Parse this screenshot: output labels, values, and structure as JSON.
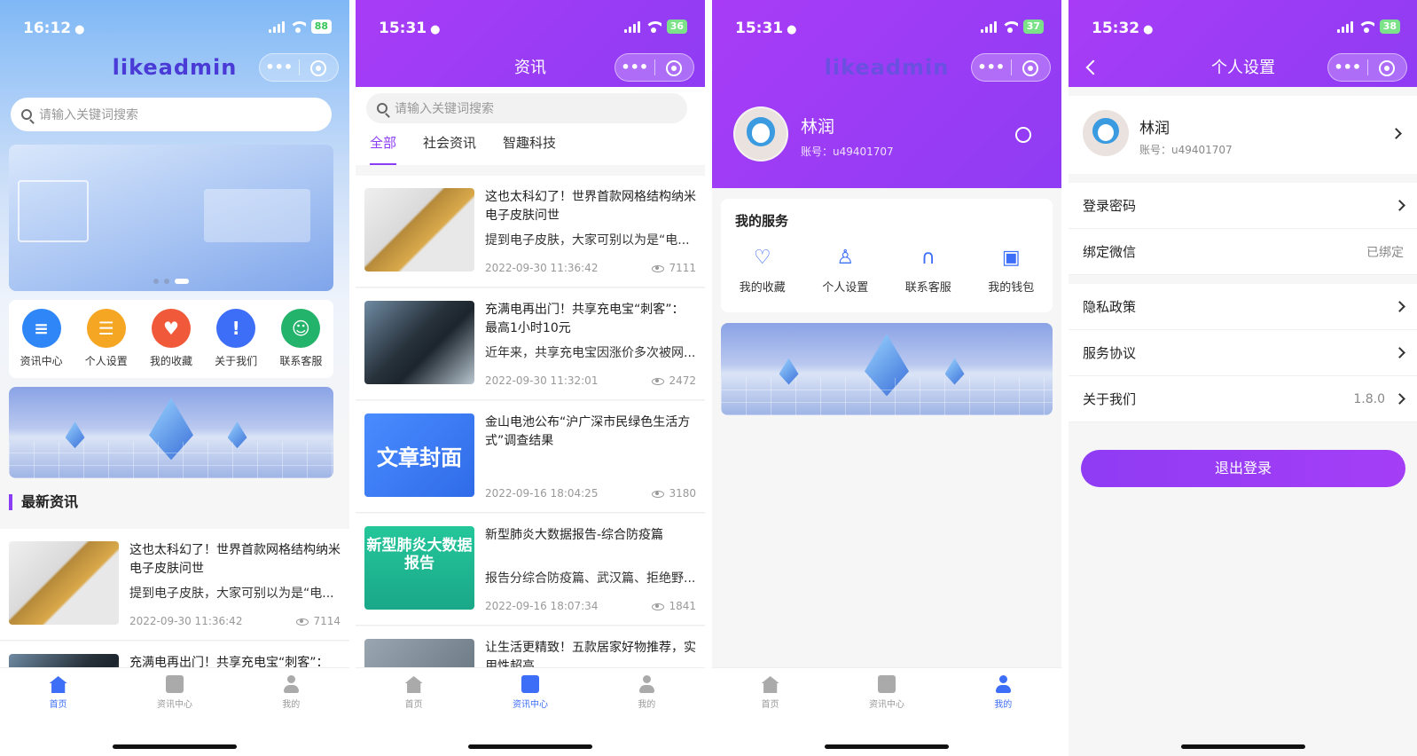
{
  "p1": {
    "time": "16:12",
    "battery": "88",
    "logo": "likeadmin",
    "search_placeholder": "请输入关键词搜索",
    "menu": [
      "资讯中心",
      "个人设置",
      "我的收藏",
      "关于我们",
      "联系客服"
    ],
    "section_title": "最新资讯",
    "news": [
      {
        "title": "这也太科幻了！世界首款网格结构纳米电子皮肤问世",
        "desc": "提到电子皮肤，大家可别以为是“电...",
        "date": "2022-09-30 11:36:42",
        "views": "7114"
      },
      {
        "title": "充满电再出门！共享充电宝“刺客”：",
        "desc": "",
        "date": "",
        "views": ""
      }
    ]
  },
  "p2": {
    "time": "15:31",
    "battery": "36",
    "title": "资讯",
    "search_placeholder": "请输入关键词搜索",
    "tabs": [
      "全部",
      "社会资讯",
      "智趣科技"
    ],
    "news": [
      {
        "title": "这也太科幻了！世界首款网格结构纳米电子皮肤问世",
        "desc": "提到电子皮肤，大家可别以为是“电...",
        "date": "2022-09-30 11:36:42",
        "views": "7111"
      },
      {
        "title": "充满电再出门！共享充电宝“刺客”：最高1小时10元",
        "desc": "近年来，共享充电宝因涨价多次被网...",
        "date": "2022-09-30 11:32:01",
        "views": "2472"
      },
      {
        "title": "金山电池公布“沪广深市民绿色生活方式”调查结果",
        "desc": "",
        "date": "2022-09-16 18:04:25",
        "views": "3180",
        "thumb_text": "文章封面"
      },
      {
        "title": "新型肺炎大数据报告-综合防疫篇",
        "desc": "报告分综合防疫篇、武汉篇、拒绝野...",
        "date": "2022-09-16 18:07:34",
        "views": "1841",
        "thumb_text": "新型肺炎大数据报告"
      },
      {
        "title": "让生活更精致！五款居家好物推荐，实用性超高",
        "desc": "",
        "date": "",
        "views": ""
      }
    ]
  },
  "p3": {
    "time": "15:31",
    "battery": "37",
    "logo": "likeadmin",
    "name": "林润",
    "account": "账号：u49401707",
    "services_title": "我的服务",
    "services": [
      "我的收藏",
      "个人设置",
      "联系客服",
      "我的钱包"
    ]
  },
  "p4": {
    "time": "15:32",
    "battery": "38",
    "title": "个人设置",
    "name": "林润",
    "account": "账号：u49401707",
    "rows": [
      {
        "label": "登录密码",
        "value": ""
      },
      {
        "label": "绑定微信",
        "value": "已绑定"
      },
      {
        "label": "隐私政策",
        "value": ""
      },
      {
        "label": "服务协议",
        "value": ""
      },
      {
        "label": "关于我们",
        "value": "1.8.0"
      }
    ],
    "logout": "退出登录"
  },
  "tabbar": [
    "首页",
    "资讯中心",
    "我的"
  ],
  "colors": {
    "primary": "#8f3cf4",
    "tab_active": "#3d6ef7",
    "logo": "#4a3ad6"
  }
}
